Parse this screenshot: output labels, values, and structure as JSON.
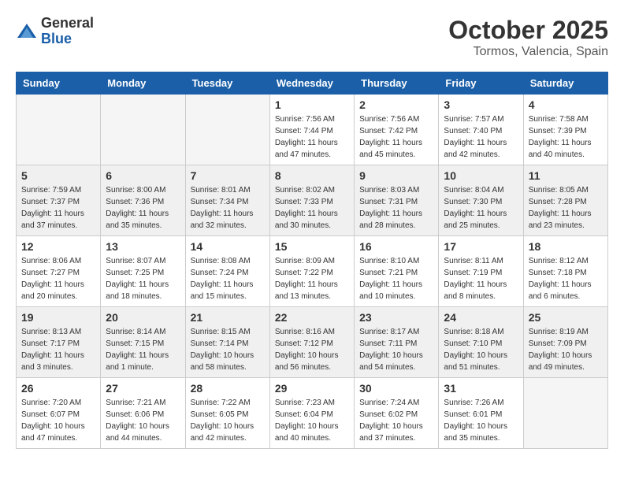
{
  "logo": {
    "general": "General",
    "blue": "Blue"
  },
  "title": "October 2025",
  "subtitle": "Tormos, Valencia, Spain",
  "days_of_week": [
    "Sunday",
    "Monday",
    "Tuesday",
    "Wednesday",
    "Thursday",
    "Friday",
    "Saturday"
  ],
  "weeks": [
    [
      {
        "day": null
      },
      {
        "day": null
      },
      {
        "day": null
      },
      {
        "day": "1",
        "sunrise": "Sunrise: 7:56 AM",
        "sunset": "Sunset: 7:44 PM",
        "daylight": "Daylight: 11 hours and 47 minutes."
      },
      {
        "day": "2",
        "sunrise": "Sunrise: 7:56 AM",
        "sunset": "Sunset: 7:42 PM",
        "daylight": "Daylight: 11 hours and 45 minutes."
      },
      {
        "day": "3",
        "sunrise": "Sunrise: 7:57 AM",
        "sunset": "Sunset: 7:40 PM",
        "daylight": "Daylight: 11 hours and 42 minutes."
      },
      {
        "day": "4",
        "sunrise": "Sunrise: 7:58 AM",
        "sunset": "Sunset: 7:39 PM",
        "daylight": "Daylight: 11 hours and 40 minutes."
      }
    ],
    [
      {
        "day": "5",
        "sunrise": "Sunrise: 7:59 AM",
        "sunset": "Sunset: 7:37 PM",
        "daylight": "Daylight: 11 hours and 37 minutes."
      },
      {
        "day": "6",
        "sunrise": "Sunrise: 8:00 AM",
        "sunset": "Sunset: 7:36 PM",
        "daylight": "Daylight: 11 hours and 35 minutes."
      },
      {
        "day": "7",
        "sunrise": "Sunrise: 8:01 AM",
        "sunset": "Sunset: 7:34 PM",
        "daylight": "Daylight: 11 hours and 32 minutes."
      },
      {
        "day": "8",
        "sunrise": "Sunrise: 8:02 AM",
        "sunset": "Sunset: 7:33 PM",
        "daylight": "Daylight: 11 hours and 30 minutes."
      },
      {
        "day": "9",
        "sunrise": "Sunrise: 8:03 AM",
        "sunset": "Sunset: 7:31 PM",
        "daylight": "Daylight: 11 hours and 28 minutes."
      },
      {
        "day": "10",
        "sunrise": "Sunrise: 8:04 AM",
        "sunset": "Sunset: 7:30 PM",
        "daylight": "Daylight: 11 hours and 25 minutes."
      },
      {
        "day": "11",
        "sunrise": "Sunrise: 8:05 AM",
        "sunset": "Sunset: 7:28 PM",
        "daylight": "Daylight: 11 hours and 23 minutes."
      }
    ],
    [
      {
        "day": "12",
        "sunrise": "Sunrise: 8:06 AM",
        "sunset": "Sunset: 7:27 PM",
        "daylight": "Daylight: 11 hours and 20 minutes."
      },
      {
        "day": "13",
        "sunrise": "Sunrise: 8:07 AM",
        "sunset": "Sunset: 7:25 PM",
        "daylight": "Daylight: 11 hours and 18 minutes."
      },
      {
        "day": "14",
        "sunrise": "Sunrise: 8:08 AM",
        "sunset": "Sunset: 7:24 PM",
        "daylight": "Daylight: 11 hours and 15 minutes."
      },
      {
        "day": "15",
        "sunrise": "Sunrise: 8:09 AM",
        "sunset": "Sunset: 7:22 PM",
        "daylight": "Daylight: 11 hours and 13 minutes."
      },
      {
        "day": "16",
        "sunrise": "Sunrise: 8:10 AM",
        "sunset": "Sunset: 7:21 PM",
        "daylight": "Daylight: 11 hours and 10 minutes."
      },
      {
        "day": "17",
        "sunrise": "Sunrise: 8:11 AM",
        "sunset": "Sunset: 7:19 PM",
        "daylight": "Daylight: 11 hours and 8 minutes."
      },
      {
        "day": "18",
        "sunrise": "Sunrise: 8:12 AM",
        "sunset": "Sunset: 7:18 PM",
        "daylight": "Daylight: 11 hours and 6 minutes."
      }
    ],
    [
      {
        "day": "19",
        "sunrise": "Sunrise: 8:13 AM",
        "sunset": "Sunset: 7:17 PM",
        "daylight": "Daylight: 11 hours and 3 minutes."
      },
      {
        "day": "20",
        "sunrise": "Sunrise: 8:14 AM",
        "sunset": "Sunset: 7:15 PM",
        "daylight": "Daylight: 11 hours and 1 minute."
      },
      {
        "day": "21",
        "sunrise": "Sunrise: 8:15 AM",
        "sunset": "Sunset: 7:14 PM",
        "daylight": "Daylight: 10 hours and 58 minutes."
      },
      {
        "day": "22",
        "sunrise": "Sunrise: 8:16 AM",
        "sunset": "Sunset: 7:12 PM",
        "daylight": "Daylight: 10 hours and 56 minutes."
      },
      {
        "day": "23",
        "sunrise": "Sunrise: 8:17 AM",
        "sunset": "Sunset: 7:11 PM",
        "daylight": "Daylight: 10 hours and 54 minutes."
      },
      {
        "day": "24",
        "sunrise": "Sunrise: 8:18 AM",
        "sunset": "Sunset: 7:10 PM",
        "daylight": "Daylight: 10 hours and 51 minutes."
      },
      {
        "day": "25",
        "sunrise": "Sunrise: 8:19 AM",
        "sunset": "Sunset: 7:09 PM",
        "daylight": "Daylight: 10 hours and 49 minutes."
      }
    ],
    [
      {
        "day": "26",
        "sunrise": "Sunrise: 7:20 AM",
        "sunset": "Sunset: 6:07 PM",
        "daylight": "Daylight: 10 hours and 47 minutes."
      },
      {
        "day": "27",
        "sunrise": "Sunrise: 7:21 AM",
        "sunset": "Sunset: 6:06 PM",
        "daylight": "Daylight: 10 hours and 44 minutes."
      },
      {
        "day": "28",
        "sunrise": "Sunrise: 7:22 AM",
        "sunset": "Sunset: 6:05 PM",
        "daylight": "Daylight: 10 hours and 42 minutes."
      },
      {
        "day": "29",
        "sunrise": "Sunrise: 7:23 AM",
        "sunset": "Sunset: 6:04 PM",
        "daylight": "Daylight: 10 hours and 40 minutes."
      },
      {
        "day": "30",
        "sunrise": "Sunrise: 7:24 AM",
        "sunset": "Sunset: 6:02 PM",
        "daylight": "Daylight: 10 hours and 37 minutes."
      },
      {
        "day": "31",
        "sunrise": "Sunrise: 7:26 AM",
        "sunset": "Sunset: 6:01 PM",
        "daylight": "Daylight: 10 hours and 35 minutes."
      },
      {
        "day": null
      }
    ]
  ]
}
